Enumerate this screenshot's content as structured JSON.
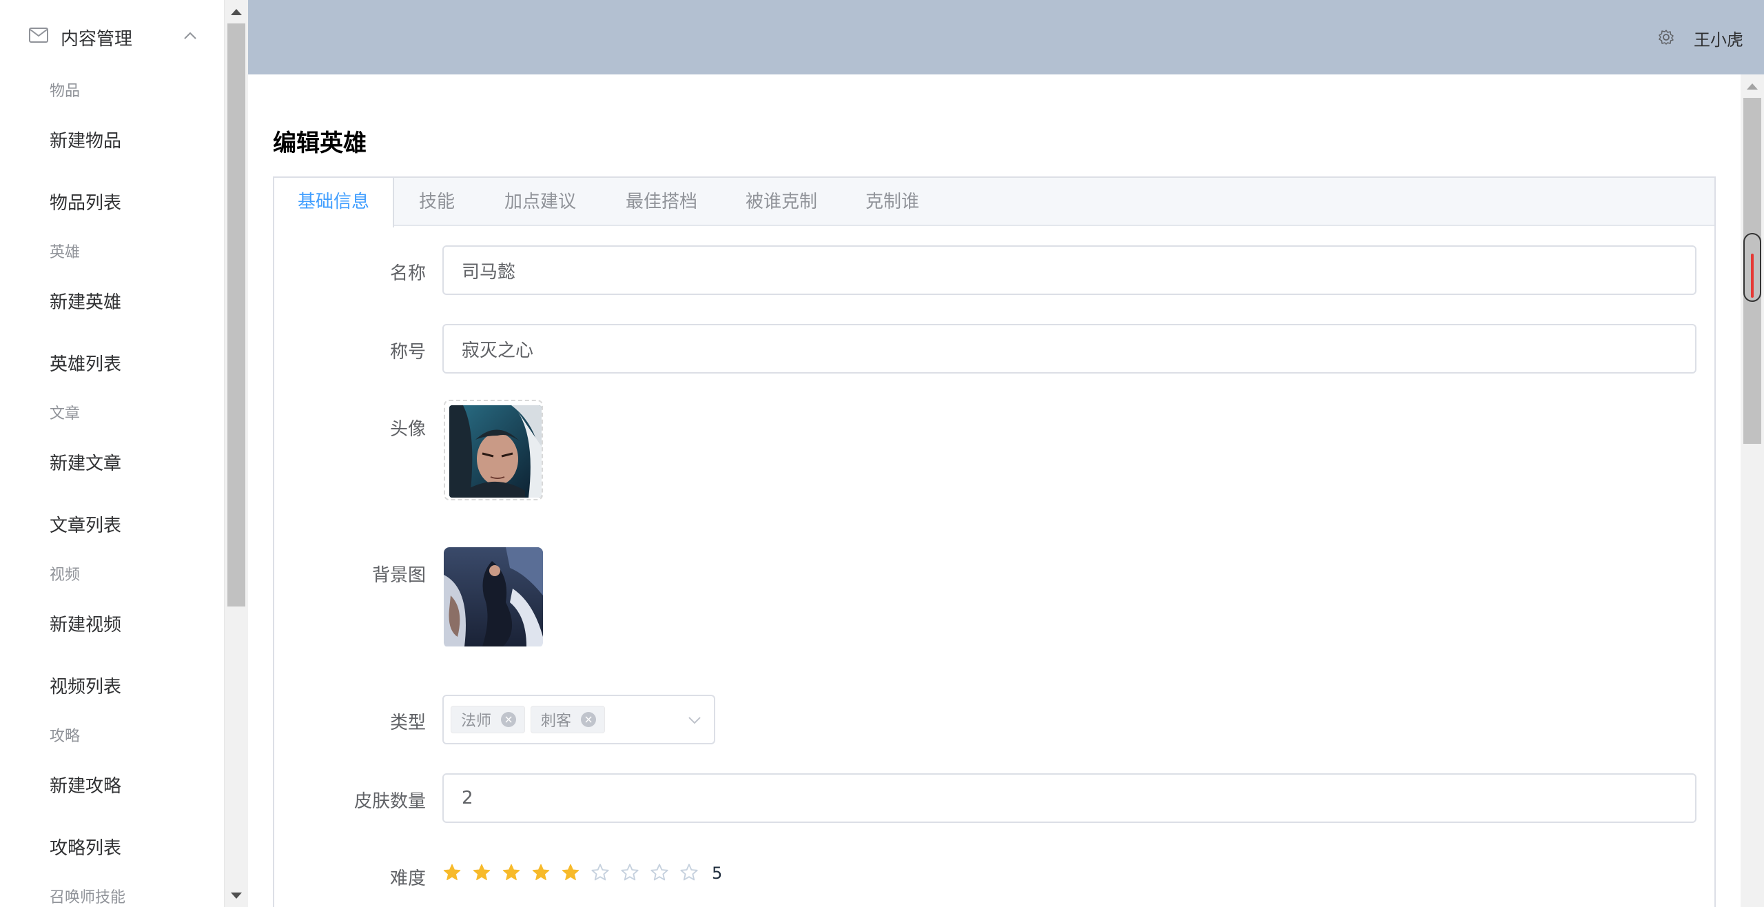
{
  "user": {
    "name": "王小虎"
  },
  "sidebar": {
    "menu_title": "内容管理",
    "groups": [
      {
        "title": "物品",
        "items": [
          "新建物品",
          "物品列表"
        ]
      },
      {
        "title": "英雄",
        "items": [
          "新建英雄",
          "英雄列表"
        ]
      },
      {
        "title": "文章",
        "items": [
          "新建文章",
          "文章列表"
        ]
      },
      {
        "title": "视频",
        "items": [
          "新建视频",
          "视频列表"
        ]
      },
      {
        "title": "攻略",
        "items": [
          "新建攻略",
          "攻略列表"
        ]
      },
      {
        "title": "召唤师技能",
        "items": []
      }
    ]
  },
  "page": {
    "title": "编辑英雄"
  },
  "tabs": [
    "基础信息",
    "技能",
    "加点建议",
    "最佳搭档",
    "被谁克制",
    "克制谁"
  ],
  "form": {
    "name": {
      "label": "名称",
      "value": "司马懿"
    },
    "title": {
      "label": "称号",
      "value": "寂灭之心"
    },
    "avatar": {
      "label": "头像"
    },
    "background": {
      "label": "背景图"
    },
    "type": {
      "label": "类型",
      "tags": [
        "法师",
        "刺客"
      ]
    },
    "skins": {
      "label": "皮肤数量",
      "value": "2"
    },
    "difficulty": {
      "label": "难度",
      "value": 5,
      "max": 9,
      "display": "5"
    }
  },
  "colors": {
    "header_bg": "#b3c0d1",
    "active_tab": "#409eff",
    "star_on": "#f7ba2a",
    "star_off": "#c6d1de"
  }
}
